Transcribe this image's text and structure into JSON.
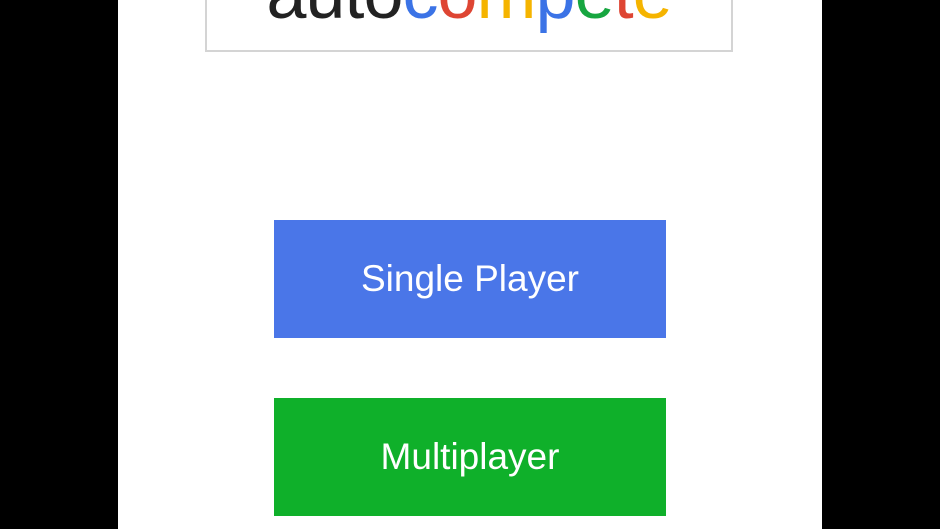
{
  "logo": {
    "letters": [
      {
        "char": "a",
        "color": "#222222"
      },
      {
        "char": "u",
        "color": "#222222"
      },
      {
        "char": "t",
        "color": "#222222"
      },
      {
        "char": "o",
        "color": "#222222"
      },
      {
        "char": "c",
        "color": "#3b73e6"
      },
      {
        "char": "o",
        "color": "#de4533"
      },
      {
        "char": "m",
        "color": "#f5b400"
      },
      {
        "char": "p",
        "color": "#3b73e6"
      },
      {
        "char": "e",
        "color": "#17a640"
      },
      {
        "char": "t",
        "color": "#de4533"
      },
      {
        "char": "e",
        "color": "#f5b400"
      }
    ]
  },
  "menu": {
    "single_player": {
      "label": "Single Player",
      "color": "#4a76e8"
    },
    "multiplayer": {
      "label": "Multiplayer",
      "color": "#0fb02a"
    }
  }
}
